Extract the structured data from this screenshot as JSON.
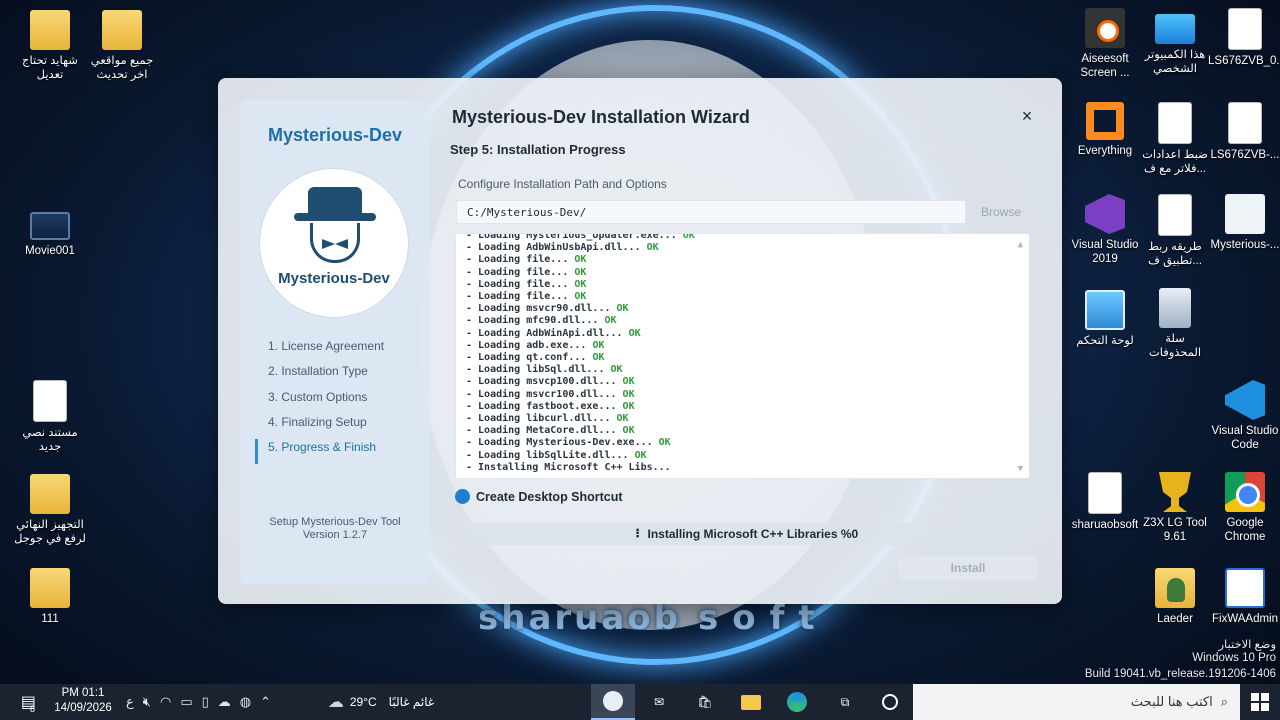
{
  "desktop": {
    "watermark_left": "sharuaob",
    "watermark_right": "soft",
    "icons": [
      {
        "label": "جميع مواقعي اخر تحديث",
        "icon": "word-folder-icon"
      },
      {
        "label": "شهايد تحتاج تعديل",
        "icon": "folder-icon"
      },
      {
        "label": "Movie001",
        "icon": "movie-icon"
      },
      {
        "label": "مستند نصي جديد",
        "icon": "text-file-icon"
      },
      {
        "label": "التجهيز النهائي لرفع في جوجل",
        "icon": "folder-icon"
      },
      {
        "label": "111",
        "icon": "folder-icon"
      },
      {
        "label": "LS676ZVB_0...",
        "icon": "file-icon"
      },
      {
        "label": "هذا الكمبيوتر الشخصي",
        "icon": "computer-icon"
      },
      {
        "label": "Aiseesoft Screen ...",
        "icon": "screen-recorder-icon"
      },
      {
        "label": "LS676ZVB-...",
        "icon": "file-icon"
      },
      {
        "label": "ضبط اعدادات فلاتر مع ف...",
        "icon": "text-file-icon"
      },
      {
        "label": "Everything",
        "icon": "everything-icon"
      },
      {
        "label": "Mysterious-...",
        "icon": "mysterious-dev-icon"
      },
      {
        "label": "طريقه ربط تطبيق ف...",
        "icon": "text-file-icon"
      },
      {
        "label": "Visual Studio 2019",
        "icon": "visual-studio-icon"
      },
      {
        "label": "سلة المحذوفات",
        "icon": "recycle-bin-icon"
      },
      {
        "label": "لوحة التحكم",
        "icon": "control-panel-icon"
      },
      {
        "label": "Visual Studio Code",
        "icon": "vscode-icon"
      },
      {
        "label": "Google Chrome",
        "icon": "chrome-icon"
      },
      {
        "label": "Z3X LG Tool 9.61",
        "icon": "trophy-icon"
      },
      {
        "label": "sharuaobsoft",
        "icon": "chrome-file-icon"
      },
      {
        "label": "FixWAAdmin",
        "icon": "app-window-icon"
      },
      {
        "label": "Laeder",
        "icon": "user-folder-icon"
      }
    ],
    "windows_watermark": {
      "line1": "وضع الاختبار",
      "line2": "Windows 10 Pro",
      "line3": "Build 19041.vb_release.191206-1406"
    }
  },
  "wizard": {
    "brand": "Mysterious-Dev",
    "logo_text": "Mysterious-Dev",
    "title": "Mysterious-Dev Installation Wizard",
    "close_glyph": "×",
    "step_title": "Step 5: Installation Progress",
    "steps": [
      {
        "label": "1. License Agreement",
        "active": false
      },
      {
        "label": "2. Installation Type",
        "active": false
      },
      {
        "label": "3. Custom Options",
        "active": false
      },
      {
        "label": "4. Finalizing Setup",
        "active": false
      },
      {
        "label": "5. Progress & Finish",
        "active": true
      }
    ],
    "footer_line1": "Setup Mysterious-Dev Tool",
    "footer_line2": "Version 1.2.7",
    "config_label": "Configure Installation Path and Options",
    "path_value": "C:/Mysterious-Dev/",
    "browse_label": "Browse",
    "log_lines": [
      {
        "text": "- Loading Mysterious_Updater.exe...",
        "status": "OK"
      },
      {
        "text": "- Loading AdbWinUsbApi.dll...",
        "status": "OK"
      },
      {
        "text": "- Loading file...",
        "status": "OK"
      },
      {
        "text": "- Loading file...",
        "status": "OK"
      },
      {
        "text": "- Loading file...",
        "status": "OK"
      },
      {
        "text": "- Loading file...",
        "status": "OK"
      },
      {
        "text": "- Loading msvcr90.dll...",
        "status": "OK"
      },
      {
        "text": "- Loading mfc90.dll...",
        "status": "OK"
      },
      {
        "text": "- Loading AdbWinApi.dll...",
        "status": "OK"
      },
      {
        "text": "- Loading adb.exe...",
        "status": "OK"
      },
      {
        "text": "- Loading qt.conf...",
        "status": "OK"
      },
      {
        "text": "- Loading libSql.dll...",
        "status": "OK"
      },
      {
        "text": "- Loading msvcp100.dll...",
        "status": "OK"
      },
      {
        "text": "- Loading msvcr100.dll...",
        "status": "OK"
      },
      {
        "text": "- Loading fastboot.exe...",
        "status": "OK"
      },
      {
        "text": "- Loading libcurl.dll...",
        "status": "OK"
      },
      {
        "text": "- Loading MetaCore.dll...",
        "status": "OK"
      },
      {
        "text": "- Loading Mysterious-Dev.exe...",
        "status": "OK"
      },
      {
        "text": "- Loading libSqlLite.dll...",
        "status": "OK"
      },
      {
        "text": "- Installing Microsoft C++ Libs...",
        "status": ""
      }
    ],
    "shortcut_label": "Create Desktop Shortcut",
    "shortcut_checked": true,
    "status_text": "⠇ Installing Microsoft C++ Libraries %0",
    "install_label": "Install"
  },
  "taskbar": {
    "clock_time": "PM 01:1",
    "clock_date": "14/09/2026",
    "notification_count": "8",
    "lang": "ع",
    "weather_temp": "29°C",
    "weather_text": "غائم غالبًا",
    "search_placeholder": "اكتب هنا للبحث",
    "apps": [
      "mysterious-dev-app-icon",
      "mail-icon",
      "store-icon",
      "file-explorer-icon",
      "edge-icon",
      "task-view-icon",
      "cortana-icon"
    ]
  }
}
